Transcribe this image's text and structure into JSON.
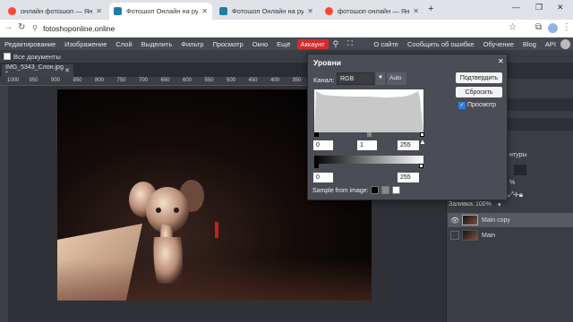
{
  "browser": {
    "tabs": [
      {
        "title": "онлайн фотошоп — Яндекс: н",
        "color": "#ff4433",
        "active": false
      },
      {
        "title": "Фотошоп Онлайн на русском",
        "color": "#1e7fa8",
        "active": true
      },
      {
        "title": "Фотошоп Онлайн на русском",
        "color": "#1e7fa8",
        "active": false
      },
      {
        "title": "фотошоп онлайн — Яндекс: н",
        "color": "#ff4433",
        "active": false
      }
    ],
    "url": "fotoshoponline.online"
  },
  "menu": {
    "items": [
      "Редактирование",
      "Изображение",
      "Слой",
      "Выделить",
      "Фильтр",
      "Просмотр",
      "Окно",
      "Ещё"
    ],
    "account": "Аккаунт",
    "right": [
      "О сайте",
      "Сообщить об ошибке",
      "Обучение",
      "Blog",
      "API"
    ]
  },
  "docbar": {
    "all_docs": "Все документы"
  },
  "doc_tab": {
    "name": "IMG_5343_Слон.jpg *"
  },
  "ruler": {
    "labels": [
      "1000",
      "950",
      "900",
      "850",
      "800",
      "750",
      "700",
      "650",
      "600",
      "550",
      "500",
      "450",
      "400",
      "350",
      "300",
      "250",
      "200",
      "150",
      "100",
      "50"
    ]
  },
  "levels": {
    "title": "Уровни",
    "channel_label": "Канал:",
    "channel_value": "RGB",
    "auto": "Auto",
    "confirm": "Подтвердить",
    "reset": "Сбросить",
    "preview": "Просмотр",
    "input_black": "0",
    "input_gamma": "1",
    "input_white": "255",
    "output_black": "0",
    "output_white": "255",
    "sample_label": "Sample from image:"
  },
  "panel": {
    "contours": "нтуры",
    "pct": "%",
    "fill_label": "Заливка:",
    "fill_value": "100%",
    "layers": [
      {
        "name": "Main copy",
        "visible": true,
        "selected": true
      },
      {
        "name": "Main",
        "visible": false,
        "selected": false
      }
    ]
  }
}
